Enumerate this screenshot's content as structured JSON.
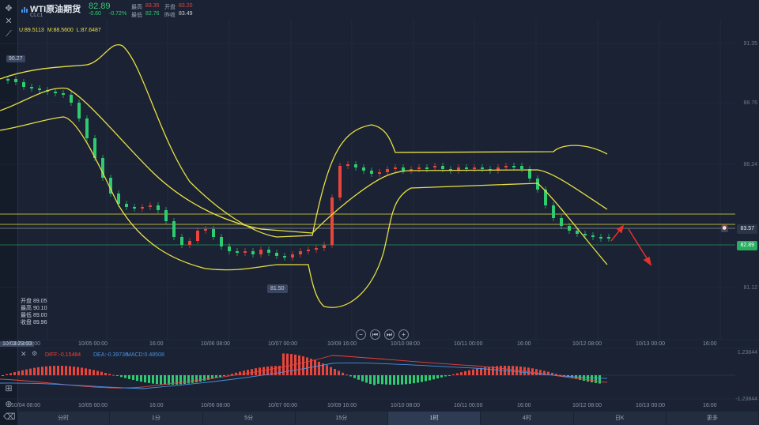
{
  "header": {
    "title": "WTI原油期货",
    "code": "CLc1",
    "price": "82.89",
    "change": "-0.60",
    "change_pct": "-0.72%",
    "high_label": "最高",
    "high": "83.35",
    "open_label": "开盘",
    "open": "83.20",
    "low_label": "最低",
    "low": "82.76",
    "prev_label": "昨收",
    "prev": "83.49"
  },
  "bollinger": {
    "upper": "U:89.5113",
    "middle": "M:88.5600",
    "lower": "L:87.6487"
  },
  "ohlc_box": [
    {
      "label": "开盘",
      "value": "89.05"
    },
    {
      "label": "最高",
      "value": "90.10"
    },
    {
      "label": "最低",
      "value": "89.00"
    },
    {
      "label": "收盘",
      "value": "89.96"
    }
  ],
  "y_axis": [
    "91.35",
    "88.76",
    "86.24",
    "83.57",
    "81.12"
  ],
  "marks": {
    "high_mark": "90.27",
    "low_mark": "81.50"
  },
  "price_tags": {
    "line": "83.57",
    "current": "82.89"
  },
  "x_axis": [
    "10/04 08:00",
    "10/05 00:00",
    "16:00",
    "10/06 08:00",
    "10/07 00:00",
    "10/09 16:00",
    "10/10 08:00",
    "10/11 00:00",
    "16:00",
    "10/12 08:00",
    "10/13 00:00",
    "16:00"
  ],
  "crosshair_date": "10/03 23:00",
  "macd": {
    "diff": "DIFF:-0.15484",
    "dea": "DEA:-0.39736",
    "macd": "MACD:0.48508",
    "y_top": "1.23844",
    "y_bottom": "-1.23844",
    "x_axis": [
      "10/04 08:00",
      "10/05 00:00",
      "16:00",
      "10/06 08:00",
      "10/07 00:00",
      "10/09 16:00",
      "10/10 08:00",
      "10/11 00:00",
      "16:00",
      "10/12 08:00",
      "10/13 00:00",
      "16:00"
    ]
  },
  "tabs": [
    "分时",
    "1分",
    "5分",
    "15分",
    "1时",
    "4时",
    "日K",
    "更多"
  ],
  "active_tab": "1时",
  "colors": {
    "up": "#e8453c",
    "down": "#2ecc71",
    "band": "#e8e043",
    "bg": "#1a2233"
  }
}
